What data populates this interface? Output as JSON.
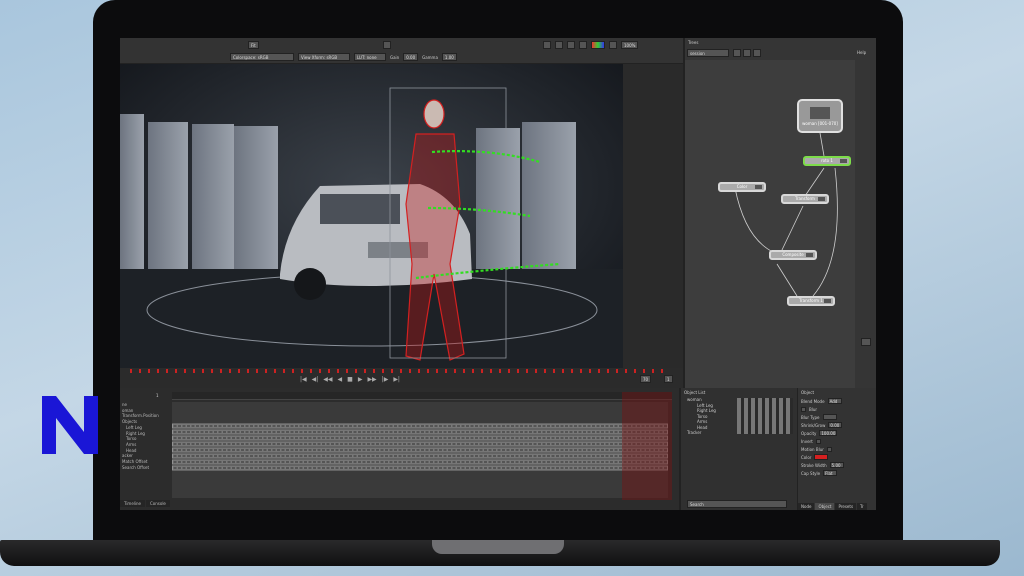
{
  "toolbar": {
    "zoom_top": "Fit",
    "colorspace": "Colorspace: sRGB",
    "view_xform": "View Xform: sRGB",
    "lut": "LUT: none",
    "gain_label": "Gain",
    "gain_value": "0.00",
    "gamma_label": "Gamma",
    "gamma_value": "1.00",
    "zoom_level": "100%"
  },
  "timeline": {
    "transport_icons": [
      "first-frame-icon",
      "prev-key-icon",
      "step-back-icon",
      "play-back-icon",
      "stop-icon",
      "play-icon",
      "step-forward-icon",
      "next-key-icon",
      "last-frame-icon"
    ],
    "current_frame": "70",
    "start_frame": "1",
    "end_frame": "1"
  },
  "dopesheet": {
    "start_label": "1",
    "rows": [
      "ne",
      "oman",
      "Transform.Position",
      "Objects",
      "Left Leg",
      "Right Leg",
      "Torso",
      "Arms",
      "Head",
      "acker",
      "Match Offset",
      "Search Offset"
    ],
    "tabs": [
      "Timeline",
      "Console"
    ]
  },
  "trees": {
    "title": "Trees",
    "tree_select": "session",
    "help": "Help",
    "nodes": {
      "source": "woman [001-070]",
      "roto": "roto 1",
      "color": "Color",
      "transform": "Transform",
      "composite": "Composite",
      "transform1": "Transform 1"
    }
  },
  "object_list": {
    "title": "Object List",
    "items": [
      "woman",
      "Left Leg",
      "Right Leg",
      "Torso",
      "Arms",
      "Head",
      "Tracker"
    ],
    "search_placeholder": "Search"
  },
  "object_panel": {
    "title": "Object",
    "blend_mode_label": "Blend Mode",
    "blend_mode_value": "Add",
    "blur_label": "Blur",
    "blur_type_label": "Blur Type",
    "shrink_grow_label": "Shrink/Grow",
    "shrink_grow_value": "0.00",
    "opacity_label": "Opacity",
    "opacity_value": "100.00",
    "invert_label": "Invert",
    "motion_blur_label": "Motion Blur",
    "color_label": "Color",
    "stroke_width_label": "Stroke Width",
    "stroke_width_value": "5.00",
    "cap_style_label": "Cap Style",
    "cap_style_value": "Flat",
    "tabs": [
      "Node",
      "Object",
      "Presets",
      "Tr"
    ]
  },
  "colors": {
    "accent_green": "#33dd22",
    "roto_red": "#d42020",
    "logo_blue": "#1a16d6"
  }
}
